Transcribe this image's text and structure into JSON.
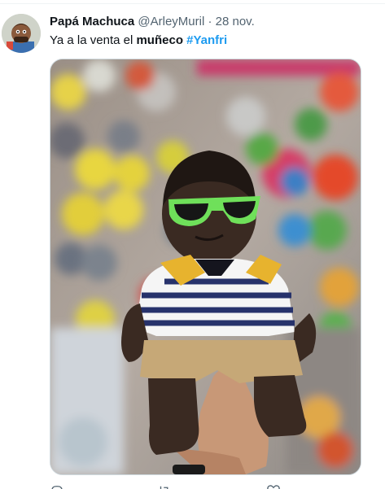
{
  "tweet": {
    "display_name": "Papá Machuca",
    "handle": "@ArleyMuril",
    "separator": "·",
    "date": "28 nov.",
    "text_prefix": "Ya a la venta el ",
    "text_bold": "muñeco",
    "text_space": " ",
    "hashtag": "#Yanfri"
  },
  "icons": {
    "avatar": "cartoon-avatar",
    "reply": "reply-icon",
    "retweet": "retweet-icon",
    "like": "like-icon"
  },
  "colors": {
    "accent": "#1d9bf0",
    "secondary_text": "#536471",
    "border": "#cfd9de"
  }
}
